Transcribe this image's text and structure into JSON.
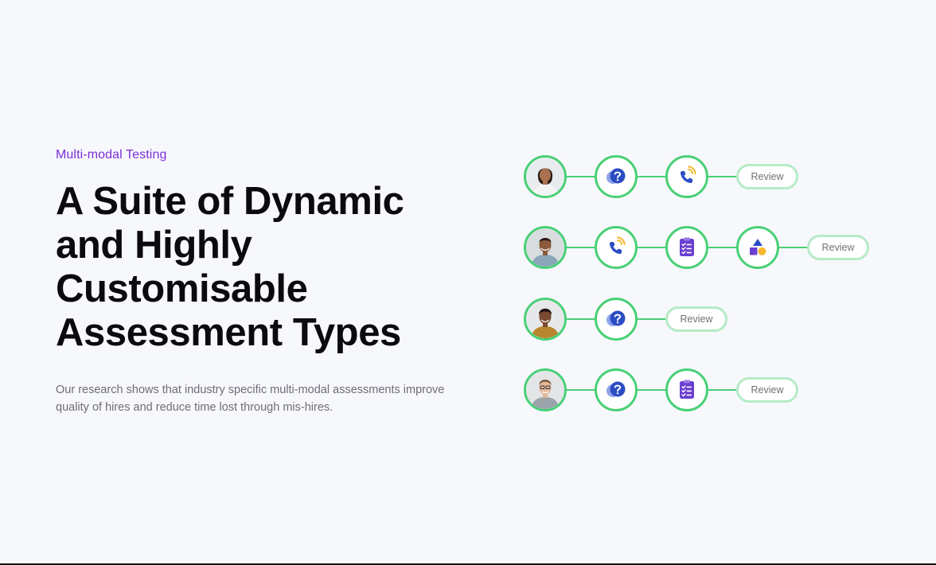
{
  "hero": {
    "eyebrow": "Multi-modal Testing",
    "headline_lines": [
      "A Suite of Dynamic",
      "and Highly",
      "Customisable",
      "Assessment Types"
    ],
    "description_lines": [
      "Our research shows that industry specific multi-modal assessments improve",
      "quality of hires and reduce time lost through mis-hires."
    ]
  },
  "flows": [
    {
      "candidate": "candidate-1",
      "steps": [
        "question-chat",
        "phone-call"
      ],
      "review_label": "Review"
    },
    {
      "candidate": "candidate-2",
      "steps": [
        "phone-call",
        "checklist-form",
        "shapes"
      ],
      "review_label": "Review"
    },
    {
      "candidate": "candidate-3",
      "steps": [
        "question-chat"
      ],
      "review_label": "Review"
    },
    {
      "candidate": "candidate-4",
      "steps": [
        "question-chat",
        "checklist-form"
      ],
      "review_label": "Review"
    }
  ],
  "colors": {
    "background": "#f7f8fc",
    "accent_purple": "#7b2fd9",
    "headline": "#0b0b0f",
    "body_text": "#6d6d78",
    "node_green": "#48d076",
    "review_border": "#b5ebc6",
    "icon_blue": "#2b4cc4",
    "icon_gold": "#f5b82e",
    "icon_purple": "#6a3fd1"
  }
}
